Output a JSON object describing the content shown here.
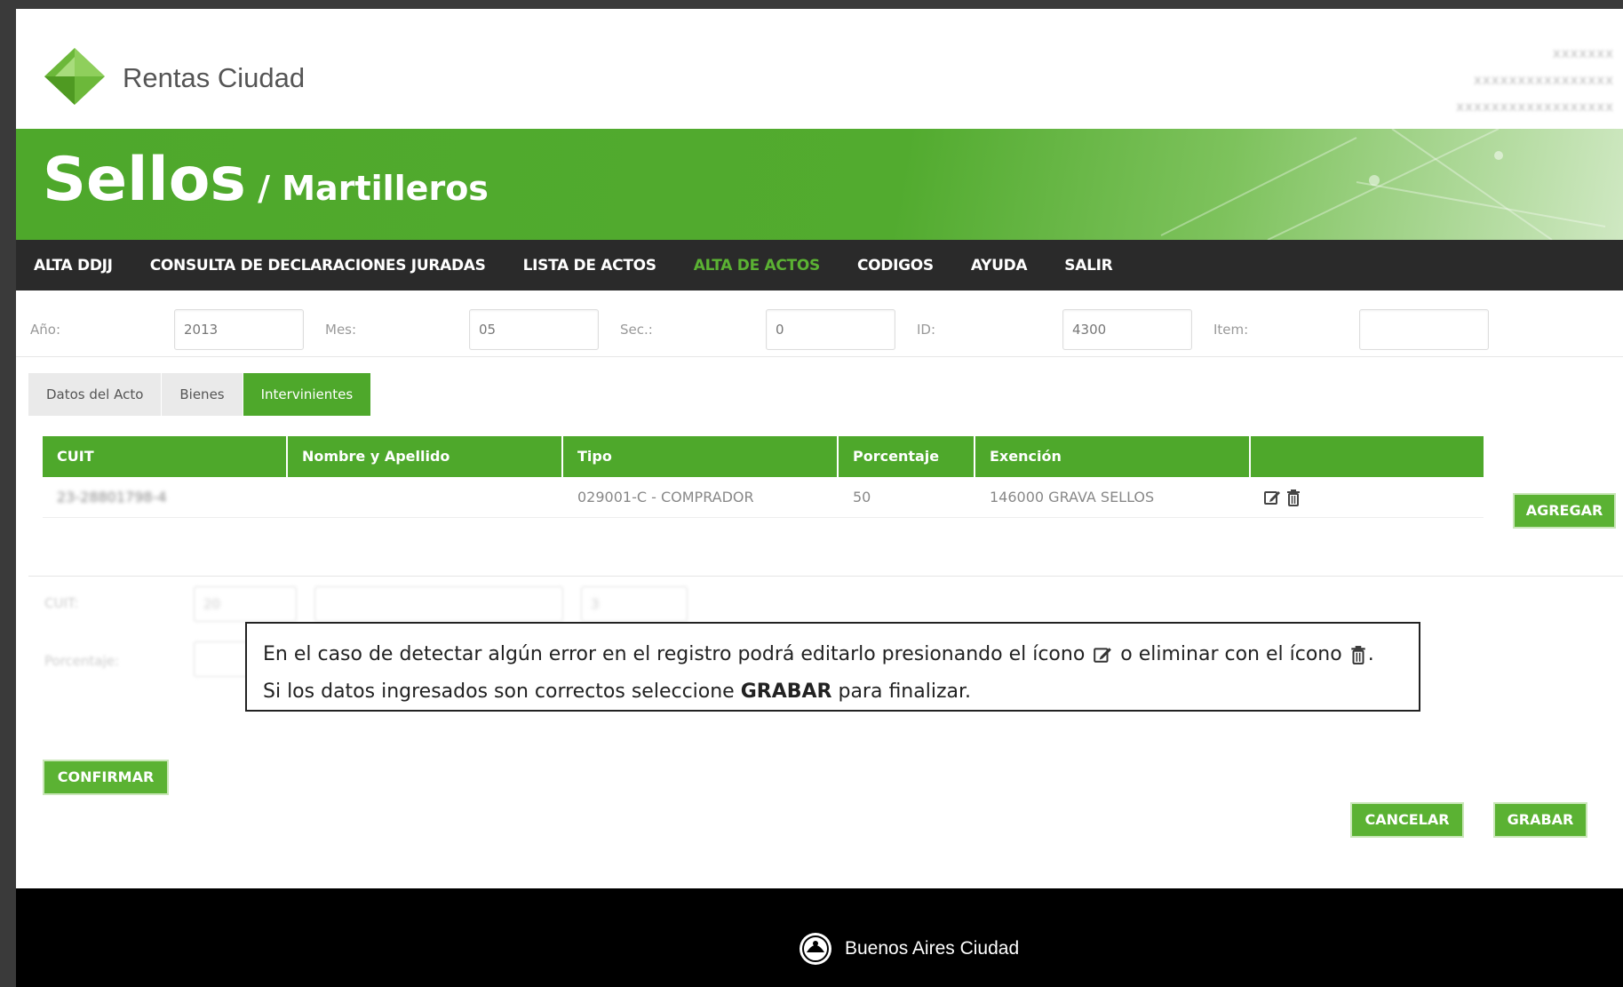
{
  "header": {
    "logo_text": "Rentas Ciudad",
    "user_lines": [
      "xxxxxxx",
      "xxxxxxxxxxxxxxxx",
      "xxxxxxxxxxxxxxxxxx"
    ]
  },
  "banner": {
    "title_main": "Sellos",
    "title_sub": " / Martilleros"
  },
  "nav": {
    "items": [
      "ALTA DDJJ",
      "CONSULTA DE DECLARACIONES JURADAS",
      "LISTA DE ACTOS",
      "ALTA DE ACTOS",
      "CODIGOS",
      "AYUDA",
      "SALIR"
    ],
    "active_index": 3
  },
  "filters": {
    "anio_label": "Año:",
    "anio_value": "2013",
    "mes_label": "Mes:",
    "mes_value": "05",
    "sec_label": "Sec.:",
    "sec_value": "0",
    "id_label": "ID:",
    "id_value": "4300",
    "item_label": "Item:",
    "item_value": ""
  },
  "tabs": [
    "Datos del Acto",
    "Bienes",
    "Intervinientes"
  ],
  "active_tab": 2,
  "table": {
    "headers": [
      "CUIT",
      "Nombre y Apellido",
      "Tipo",
      "Porcentaje",
      "Exención",
      ""
    ],
    "rows": [
      {
        "cuit": "23-28801798-4",
        "nombre": "",
        "tipo": "029001-C - COMPRADOR",
        "porcentaje": "50",
        "exencion": "146000 GRAVA SELLOS"
      }
    ]
  },
  "buttons": {
    "agregar": "AGREGAR",
    "confirmar": "CONFIRMAR",
    "cancelar": "CANCELAR",
    "grabar": "GRABAR"
  },
  "form": {
    "cuit_label": "CUIT:",
    "cuit_prefix": "20",
    "cuit_suffix": "3",
    "porcentaje_label": "Porcentaje:"
  },
  "callout": {
    "line1_a": "En el caso de detectar algún error en el registro podrá editarlo presionando el ícono",
    "line1_b": "o eliminar con el ícono",
    "line1_c": ".",
    "line2_a": "Si los datos ingresados son correctos seleccione",
    "line2_bold": "GRABAR",
    "line2_b": "para finalizar."
  },
  "footer": {
    "text": "Buenos Aires Ciudad"
  },
  "colors": {
    "brand_green": "#4ea82b",
    "nav_bg": "#2a2a2a",
    "footer_bg": "#000000"
  }
}
